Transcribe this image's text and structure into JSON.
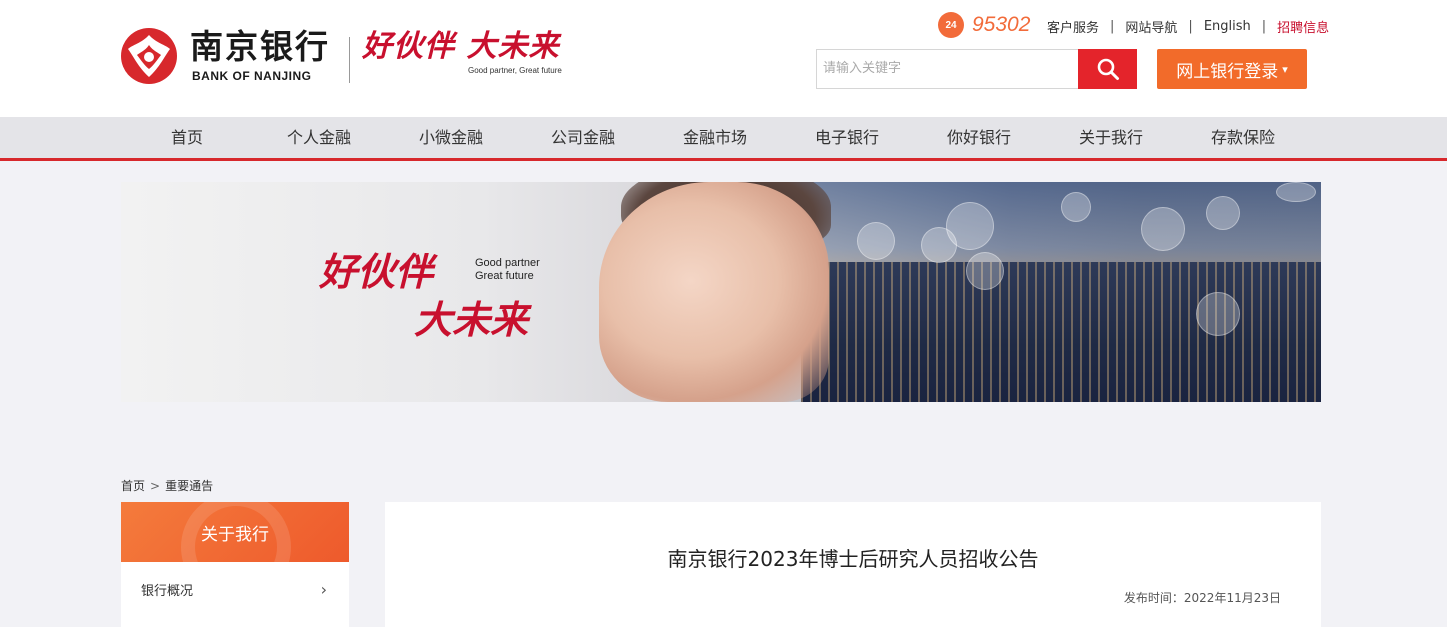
{
  "brand": {
    "name_cn": "南京银行",
    "name_en": "BANK OF NANJING",
    "slogan_cn": "好伙伴 大未来",
    "slogan_en": "Good partner, Great future",
    "accent": "#c8102e",
    "orange": "#f26b2a"
  },
  "topbar": {
    "hotline_badge": "24",
    "hotline": "95302",
    "links": [
      "客户服务",
      "网站导航",
      "English",
      "招聘信息"
    ],
    "separator": "|"
  },
  "search": {
    "placeholder": "请输入关键字",
    "icon": "search-icon"
  },
  "login": {
    "label": "网上银行登录",
    "caret": "▾"
  },
  "nav": [
    "首页",
    "个人金融",
    "小微金融",
    "公司金融",
    "金融市场",
    "电子银行",
    "你好银行",
    "关于我行",
    "存款保险"
  ],
  "banner": {
    "slogan_line1": "好伙伴",
    "slogan_line2": "大未来",
    "en_line1": "Good partner",
    "en_line2": "Great future"
  },
  "breadcrumb": {
    "home": "首页",
    "arrow": ">",
    "current": "重要通告"
  },
  "sidebar": {
    "title": "关于我行",
    "items": [
      "银行概况"
    ],
    "chevron": "›"
  },
  "article": {
    "title": "南京银行2023年博士后研究人员招收公告",
    "date_label": "发布时间：",
    "date": "2022年11月23日"
  }
}
